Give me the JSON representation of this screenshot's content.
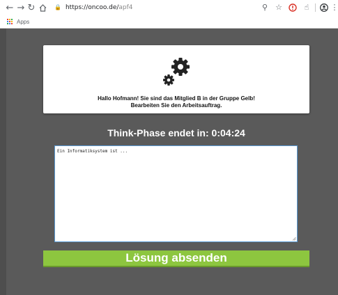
{
  "browser": {
    "url_host": "https://oncoo.de/",
    "url_path": "apf4",
    "bookmarks_label": "Apps"
  },
  "card": {
    "greeting_line1": "Hallo Hofmann! Sie sind das Mitglied B in der Gruppe Gelb!",
    "greeting_line2": "Bearbeiten Sie den Arbeitsauftrag."
  },
  "timer": {
    "label": "Think-Phase endet in: ",
    "value": "0:04:24"
  },
  "answer": {
    "value": "Ein Informatiksystem ist ..."
  },
  "submit": {
    "label": "Lösung absenden"
  },
  "colors": {
    "background": "#5a5a5a",
    "submit_button": "#8dc63f",
    "answer_border": "#5b9bd5"
  },
  "icons": {
    "back": "arrow-left",
    "forward": "arrow-right",
    "reload": "reload",
    "home": "home",
    "lock": "lock",
    "zoom": "magnifier",
    "bookmark": "star",
    "extension": "red-circle",
    "extension2": "hand",
    "profile": "account-circle",
    "menu": "kebab",
    "apps": "grid",
    "header_graphic": "gears"
  }
}
